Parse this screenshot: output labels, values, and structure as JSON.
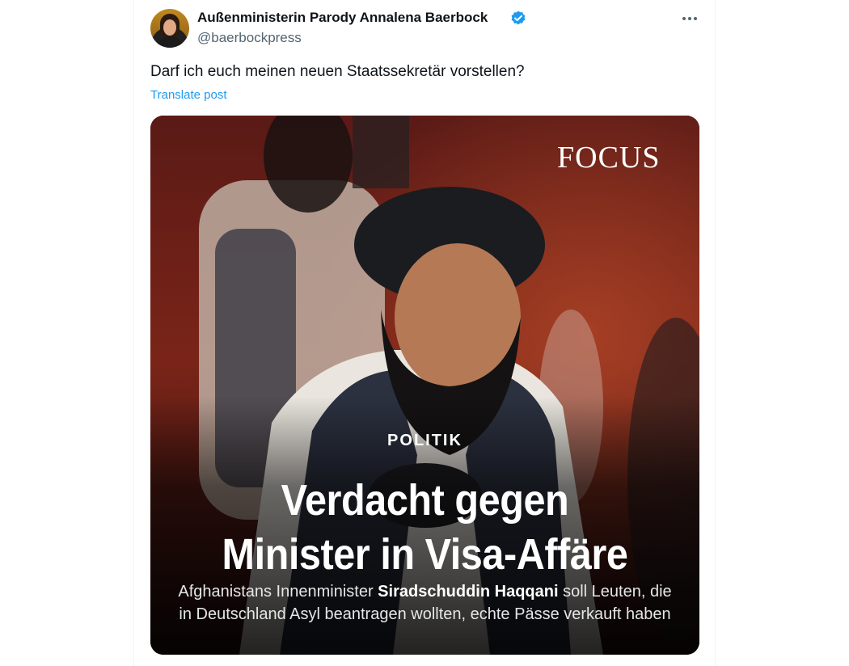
{
  "tweet": {
    "display_name": "Außenministerin Parody Annalena Baerbock",
    "handle": "@baerbockpress",
    "text": "Darf ich euch meinen neuen Staatssekretär vorstellen?",
    "translate_label": "Translate post",
    "verified": true
  },
  "media": {
    "logo": "FOCUS",
    "kicker": "POLITIK",
    "headline_line1": "Verdacht gegen",
    "headline_line2": "Minister in Visa-Affäre",
    "subtext_line1_prefix": "Afghanistans Innenminister ",
    "subtext_line1_bold": "Siradschuddin Haqqani",
    "subtext_line1_suffix": " soll Leuten, die",
    "subtext_line2": "in Deutschland Asyl beantragen wollten, echte Pässe verkauft haben"
  },
  "icons": {
    "verified": "verified-badge-icon",
    "more": "more-options-icon"
  },
  "colors": {
    "text_primary": "#0f1419",
    "text_secondary": "#536471",
    "link": "#1d9bf0",
    "verified": "#1d9bf0"
  }
}
